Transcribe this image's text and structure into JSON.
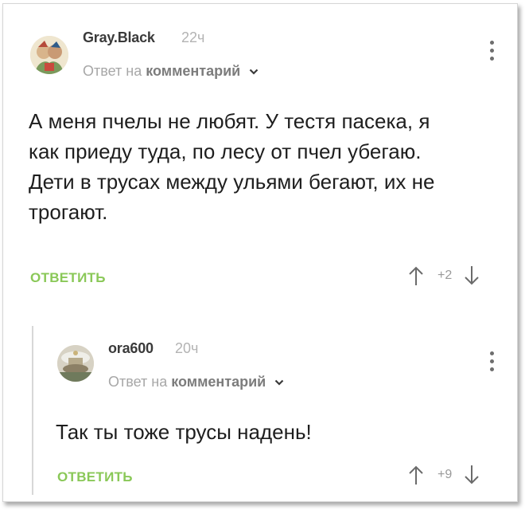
{
  "comments": [
    {
      "username": "Gray.Black",
      "time": "22ч",
      "reply_prefix": "Ответ на",
      "reply_target": "комментарий",
      "text": "А меня пчелы не любят. У тестя пасека, я как приеду туда, по лесу от пчел убегаю. Дети в трусах между ульями бегают, их не трогают.",
      "reply_label": "ОТВЕТИТЬ",
      "score": "+2"
    },
    {
      "username": "ora600",
      "time": "20ч",
      "reply_prefix": "Ответ на",
      "reply_target": "комментарий",
      "text": "Так ты тоже трусы надень!",
      "reply_label": "ОТВЕТИТЬ",
      "score": "+9"
    }
  ],
  "colors": {
    "accent": "#8ac858",
    "muted": "#a7a7a7",
    "text": "#1e1e1e"
  },
  "icons": [
    "avatar",
    "chevron-down-icon",
    "more-options-icon",
    "upvote-arrow-icon",
    "downvote-arrow-icon"
  ]
}
